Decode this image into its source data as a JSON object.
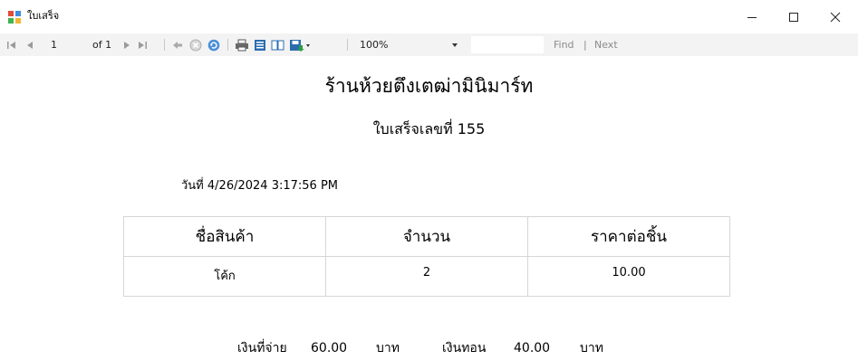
{
  "window": {
    "title": "ใบเสร็จ",
    "controls": {
      "minimize": "–",
      "maximize": "☐",
      "close": "✕"
    }
  },
  "toolbar": {
    "current_page": "1",
    "page_count_label": "of 1",
    "zoom": "100%",
    "find_label": "Find",
    "find_separator": "|",
    "next_label": "Next"
  },
  "report": {
    "store_name": "ร้านห้วยตึงเตฒ่ามินิมาร์ท",
    "receipt_title": "ใบเสร็จเลขที่ 155",
    "date_label": "วันที่",
    "date_value": "4/26/2024 3:17:56 PM",
    "table": {
      "headers": [
        "ชื่อสินค้า",
        "จำนวน",
        "ราคาต่อชิ้น"
      ],
      "rows": [
        [
          "โค้ก",
          "2",
          "10.00"
        ]
      ]
    },
    "summary": {
      "paid_label": "เงินที่จ่าย",
      "paid_value": "60.00",
      "paid_unit": "บาท",
      "change_label": "เงินทอน",
      "change_value": "40.00",
      "change_unit": "บาท"
    }
  },
  "colors": {
    "toolbar_bg": "#f3f3f3",
    "print_icon": "#2b6cb0",
    "refresh_icon": "#2e9e44"
  }
}
